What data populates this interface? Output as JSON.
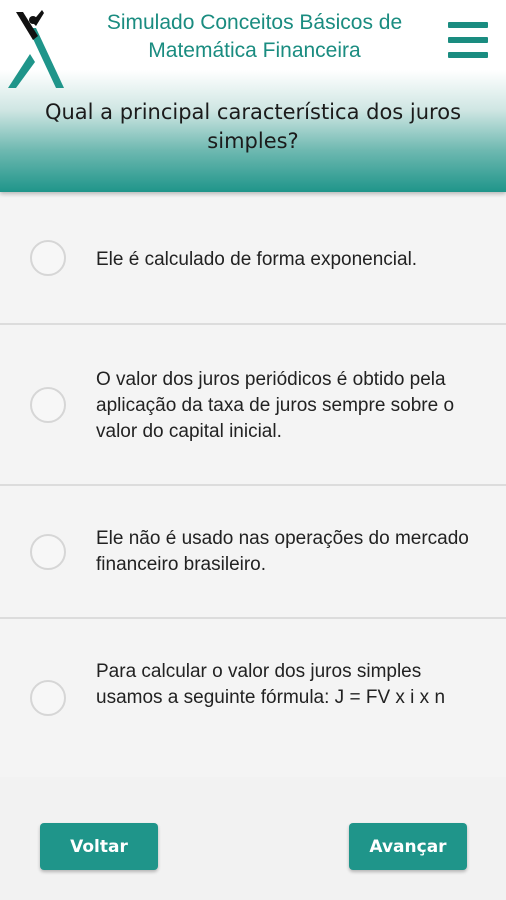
{
  "header": {
    "title": "Simulado Conceitos Básicos de\nMatemática Financeira",
    "logo_icon": "logo-icon",
    "menu_icon": "hamburger-menu-icon",
    "accent_color": "#1f958a"
  },
  "question": {
    "text": "Qual a principal característica dos juros simples?"
  },
  "options": [
    {
      "text": "Ele é calculado de forma exponencial.",
      "selected": false
    },
    {
      "text": "O valor dos juros periódicos é obtido pela aplicação da taxa de juros sempre sobre o valor do capital inicial.",
      "selected": false
    },
    {
      "text": "Ele não é usado nas operações do mercado financeiro brasileiro.",
      "selected": false
    },
    {
      "text": "Para calcular o valor dos juros simples usamos a seguinte fórmula: J = FV x i x n",
      "selected": false
    }
  ],
  "footer": {
    "back_label": "Voltar",
    "next_label": "Avançar"
  }
}
